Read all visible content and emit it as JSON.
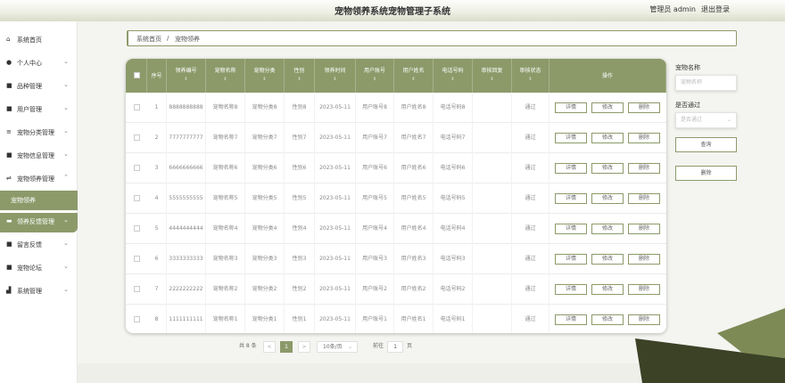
{
  "header": {
    "title": "宠物领养系统宠物管理子系统",
    "user": "管理员 admin",
    "logout": "退出登录"
  },
  "sidebar": {
    "items": [
      {
        "label": "系统首页",
        "icon": "home-icon",
        "glyph": "⌂",
        "arrow": ""
      },
      {
        "label": "个人中心",
        "icon": "user-icon",
        "glyph": "●",
        "arrow": "⌄"
      },
      {
        "label": "品种管理",
        "icon": "grid-icon",
        "glyph": "■",
        "arrow": "⌄"
      },
      {
        "label": "用户管理",
        "icon": "grid-icon",
        "glyph": "■",
        "arrow": "⌄"
      },
      {
        "label": "宠物分类管理",
        "icon": "list-icon",
        "glyph": "≡",
        "arrow": "⌄"
      },
      {
        "label": "宠物信息管理",
        "icon": "grid-icon",
        "glyph": "■",
        "arrow": "⌄"
      },
      {
        "label": "宠物领养管理",
        "icon": "sliders-icon",
        "glyph": "⇌",
        "arrow": "⌃"
      },
      {
        "label": "领养反馈管理",
        "icon": "card-icon",
        "glyph": "▬",
        "arrow": "⌄"
      },
      {
        "label": "留言反馈",
        "icon": "grid-icon",
        "glyph": "■",
        "arrow": "⌄"
      },
      {
        "label": "宠物论坛",
        "icon": "grid-icon",
        "glyph": "■",
        "arrow": "⌄"
      },
      {
        "label": "系统管理",
        "icon": "chart-icon",
        "glyph": "▟",
        "arrow": "⌄"
      }
    ],
    "sub_item": "宠物领养"
  },
  "breadcrumb": {
    "home": "系统首页",
    "sep": "/",
    "current": "宠物领养"
  },
  "table": {
    "columns": [
      {
        "label": "",
        "sort": ""
      },
      {
        "label": "序号",
        "sort": ""
      },
      {
        "label": "领养编号",
        "sort": "⇕"
      },
      {
        "label": "宠物名称",
        "sort": "⇕"
      },
      {
        "label": "宠物分类",
        "sort": "⇕"
      },
      {
        "label": "性别",
        "sort": "⇕"
      },
      {
        "label": "领养时间",
        "sort": "⇕"
      },
      {
        "label": "用户账号",
        "sort": "⇕"
      },
      {
        "label": "用户姓名",
        "sort": "⇕"
      },
      {
        "label": "电话号码",
        "sort": "⇕"
      },
      {
        "label": "审核回复",
        "sort": "⇕"
      },
      {
        "label": "审核状态",
        "sort": "⇕"
      },
      {
        "label": "操作",
        "sort": ""
      }
    ],
    "rows": [
      {
        "no": "1",
        "code": "8888888888",
        "name": "宠物名称8",
        "cat": "宠物分类8",
        "sex": "性别8",
        "date": "2023-05-11",
        "acct": "用户账号8",
        "uname": "用户姓名8",
        "phone": "电话号码8",
        "reply": "",
        "status": "通过"
      },
      {
        "no": "2",
        "code": "7777777777",
        "name": "宠物名称7",
        "cat": "宠物分类7",
        "sex": "性别7",
        "date": "2023-05-11",
        "acct": "用户账号7",
        "uname": "用户姓名7",
        "phone": "电话号码7",
        "reply": "",
        "status": "通过"
      },
      {
        "no": "3",
        "code": "6666666666",
        "name": "宠物名称6",
        "cat": "宠物分类6",
        "sex": "性别6",
        "date": "2023-05-11",
        "acct": "用户账号6",
        "uname": "用户姓名6",
        "phone": "电话号码6",
        "reply": "",
        "status": "通过"
      },
      {
        "no": "4",
        "code": "5555555555",
        "name": "宠物名称5",
        "cat": "宠物分类5",
        "sex": "性别5",
        "date": "2023-05-11",
        "acct": "用户账号5",
        "uname": "用户姓名5",
        "phone": "电话号码5",
        "reply": "",
        "status": "通过"
      },
      {
        "no": "5",
        "code": "4444444444",
        "name": "宠物名称4",
        "cat": "宠物分类4",
        "sex": "性别4",
        "date": "2023-05-11",
        "acct": "用户账号4",
        "uname": "用户姓名4",
        "phone": "电话号码4",
        "reply": "",
        "status": "通过"
      },
      {
        "no": "6",
        "code": "3333333333",
        "name": "宠物名称3",
        "cat": "宠物分类3",
        "sex": "性别3",
        "date": "2023-05-11",
        "acct": "用户账号3",
        "uname": "用户姓名3",
        "phone": "电话号码3",
        "reply": "",
        "status": "通过"
      },
      {
        "no": "7",
        "code": "2222222222",
        "name": "宠物名称2",
        "cat": "宠物分类2",
        "sex": "性别2",
        "date": "2023-05-11",
        "acct": "用户账号2",
        "uname": "用户姓名2",
        "phone": "电话号码2",
        "reply": "",
        "status": "通过"
      },
      {
        "no": "8",
        "code": "1111111111",
        "name": "宠物名称1",
        "cat": "宠物分类1",
        "sex": "性别1",
        "date": "2023-05-11",
        "acct": "用户账号1",
        "uname": "用户姓名1",
        "phone": "电话号码1",
        "reply": "",
        "status": "通过"
      }
    ],
    "actions": {
      "detail": "详情",
      "edit": "修改",
      "delete": "删除"
    }
  },
  "pagination": {
    "total": "共 8 条",
    "prev": "<",
    "page": "1",
    "next": ">",
    "page_size": "10条/页",
    "goto": "前往",
    "goto_value": "1",
    "page_unit": "页"
  },
  "search": {
    "name_label": "宠物名称",
    "name_placeholder": "宠物名称",
    "status_label": "是否通过",
    "status_placeholder": "是否通过",
    "search_button": "查询",
    "delete_button": "删除"
  },
  "colors": {
    "accent": "#8c9a6a"
  }
}
